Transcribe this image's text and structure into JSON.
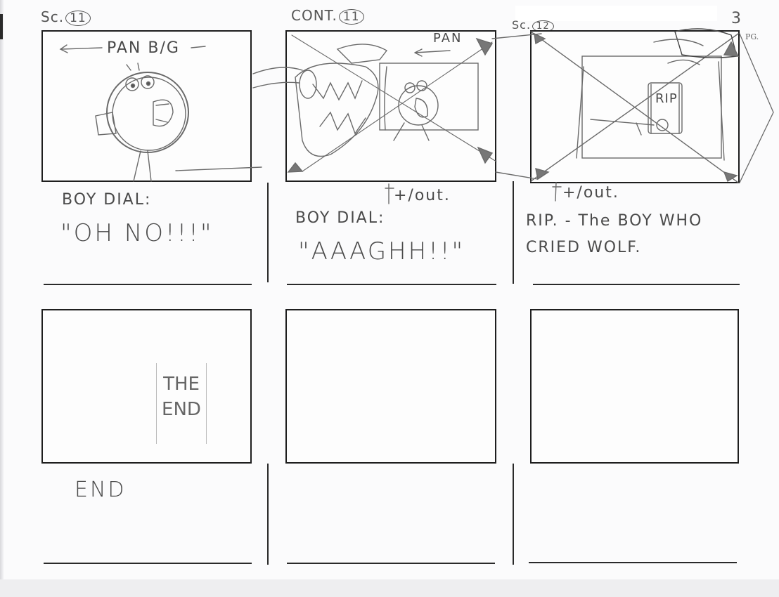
{
  "sheet": {
    "page_number": "3",
    "page_label": "PG."
  },
  "panels": [
    {
      "scene": "Sc.",
      "scene_num": "11",
      "note": "PAN B/G",
      "dialogue_label": "BOY DIAL:",
      "dialogue": "\"OH NO!!!\""
    },
    {
      "scene": "CONT.",
      "scene_num": "11",
      "note": "PAN",
      "transition": "+/out.",
      "dialogue_label": "BOY DIAL:",
      "dialogue": "\"AAAGHH!!\""
    },
    {
      "scene": "Sc.",
      "scene_num": "12",
      "tombstone": "RIP",
      "transition": "+/out.",
      "dialogue": "RIP. - The BOY WHO CRIED WOLF."
    },
    {
      "frame_text_1": "THE",
      "frame_text_2": "END",
      "dialogue": "END"
    },
    {},
    {}
  ]
}
